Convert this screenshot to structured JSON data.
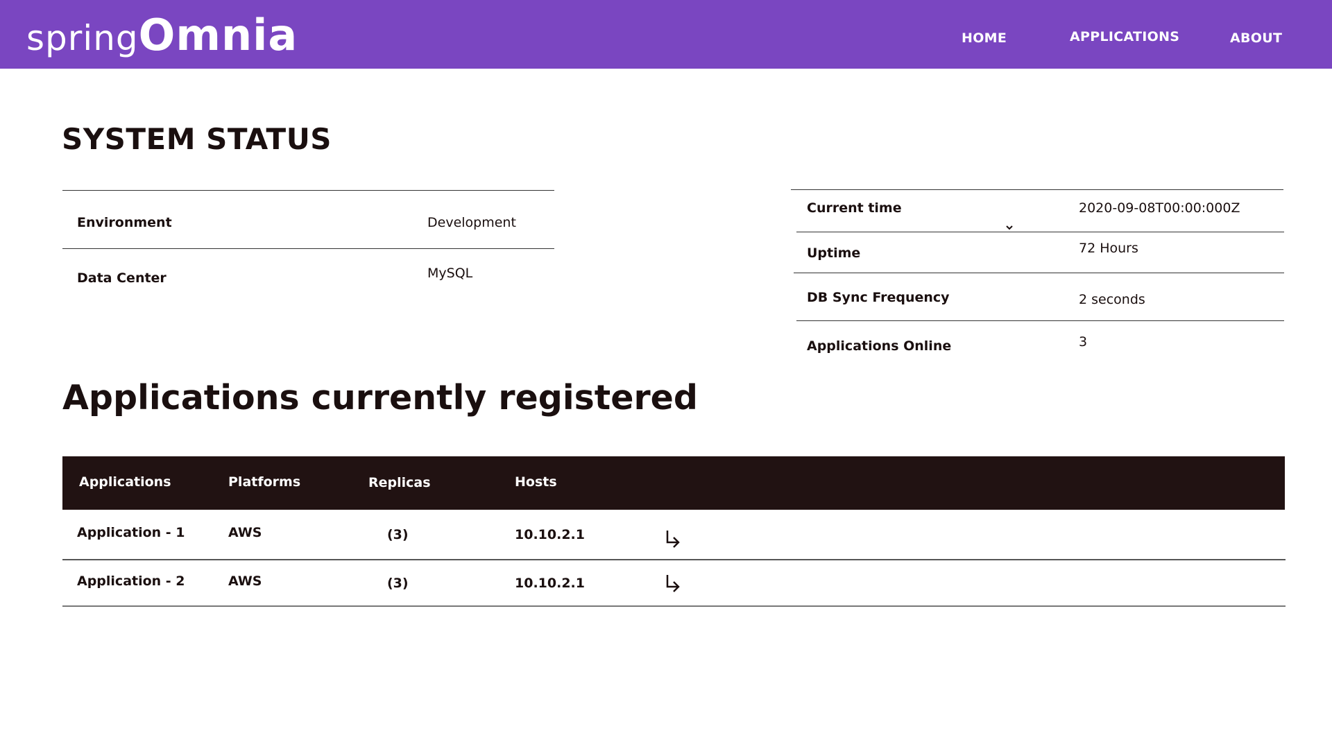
{
  "brand": {
    "part1": "spring",
    "part2": "Omnia"
  },
  "nav": {
    "home": "HOME",
    "applications": "APPLICATIONS",
    "about": "ABOUT"
  },
  "page_title": "SYSTEM STATUS",
  "status_left": [
    {
      "label": "Environment",
      "value": "Development"
    },
    {
      "label": "Data Center",
      "value": "MySQL"
    }
  ],
  "status_right": [
    {
      "label": "Current time",
      "value": "2020-09-08T00:00:000Z"
    },
    {
      "label": "Uptime",
      "value": "72 Hours"
    },
    {
      "label": "DB Sync Frequency",
      "value": "2 seconds"
    },
    {
      "label": "Applications Online",
      "value": "3"
    }
  ],
  "applications_section": {
    "title": "Applications currently registered",
    "columns": [
      "Applications",
      "Platforms",
      "Replicas",
      "Hosts"
    ],
    "rows": [
      {
        "application": "Application - 1",
        "platform": "AWS",
        "replicas": "(3)",
        "host": "10.10.2.1",
        "action_icon": "arrow-down-right-icon"
      },
      {
        "application": "Application - 2",
        "platform": "AWS",
        "replicas": "(3)",
        "host": "10.10.2.1",
        "action_icon": "arrow-down-right-icon"
      }
    ]
  },
  "colors": {
    "header_bg": "#7a46c1",
    "table_header_bg": "#211212",
    "text": "#1a0f0f"
  }
}
